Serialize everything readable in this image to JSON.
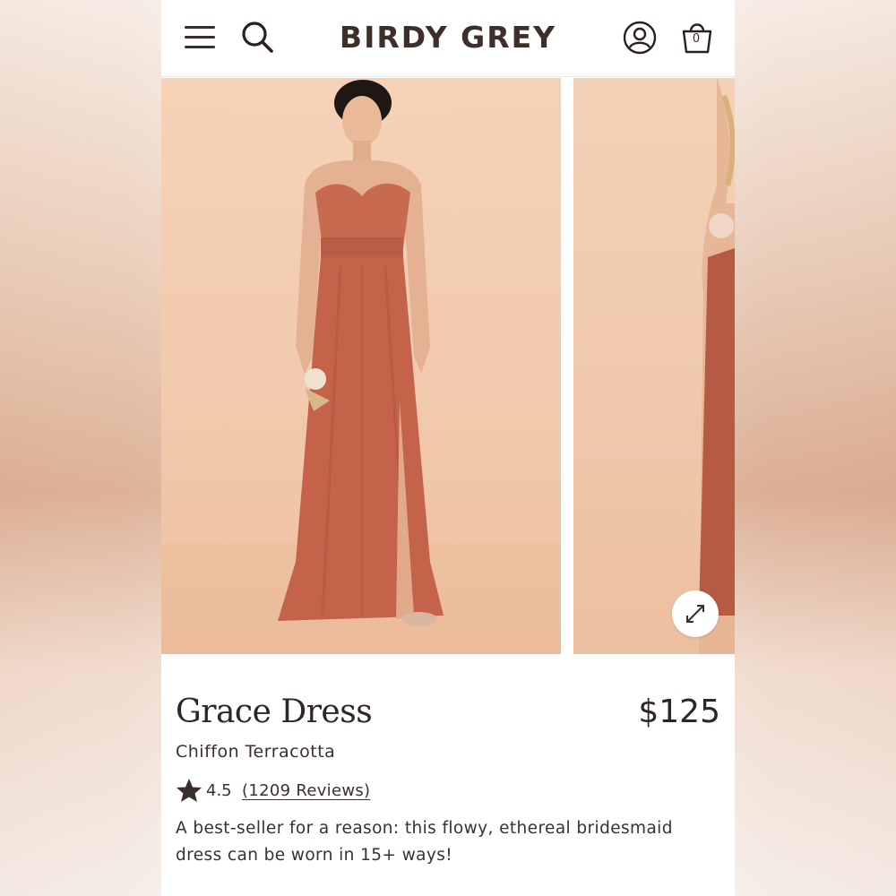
{
  "brand": {
    "logo": "BIRDY GREY"
  },
  "header": {
    "menu_icon": "hamburger-menu-icon",
    "search_icon": "search-icon",
    "account_icon": "account-icon",
    "bag_icon": "shopping-bag-icon",
    "bag_count": "0"
  },
  "gallery": {
    "expand_icon": "expand-arrows-icon"
  },
  "product": {
    "name": "Grace Dress",
    "price": "$125",
    "variant": "Chiffon Terracotta",
    "rating": "4.5",
    "reviews_label": "(1209 Reviews)",
    "description": "A best-seller for a reason: this flowy, ethereal bridesmaid dress can be worn in 15+ ways!"
  },
  "colors": {
    "text": "#2e2624",
    "dress": "#c4634a",
    "backdrop": "#f2caad"
  }
}
